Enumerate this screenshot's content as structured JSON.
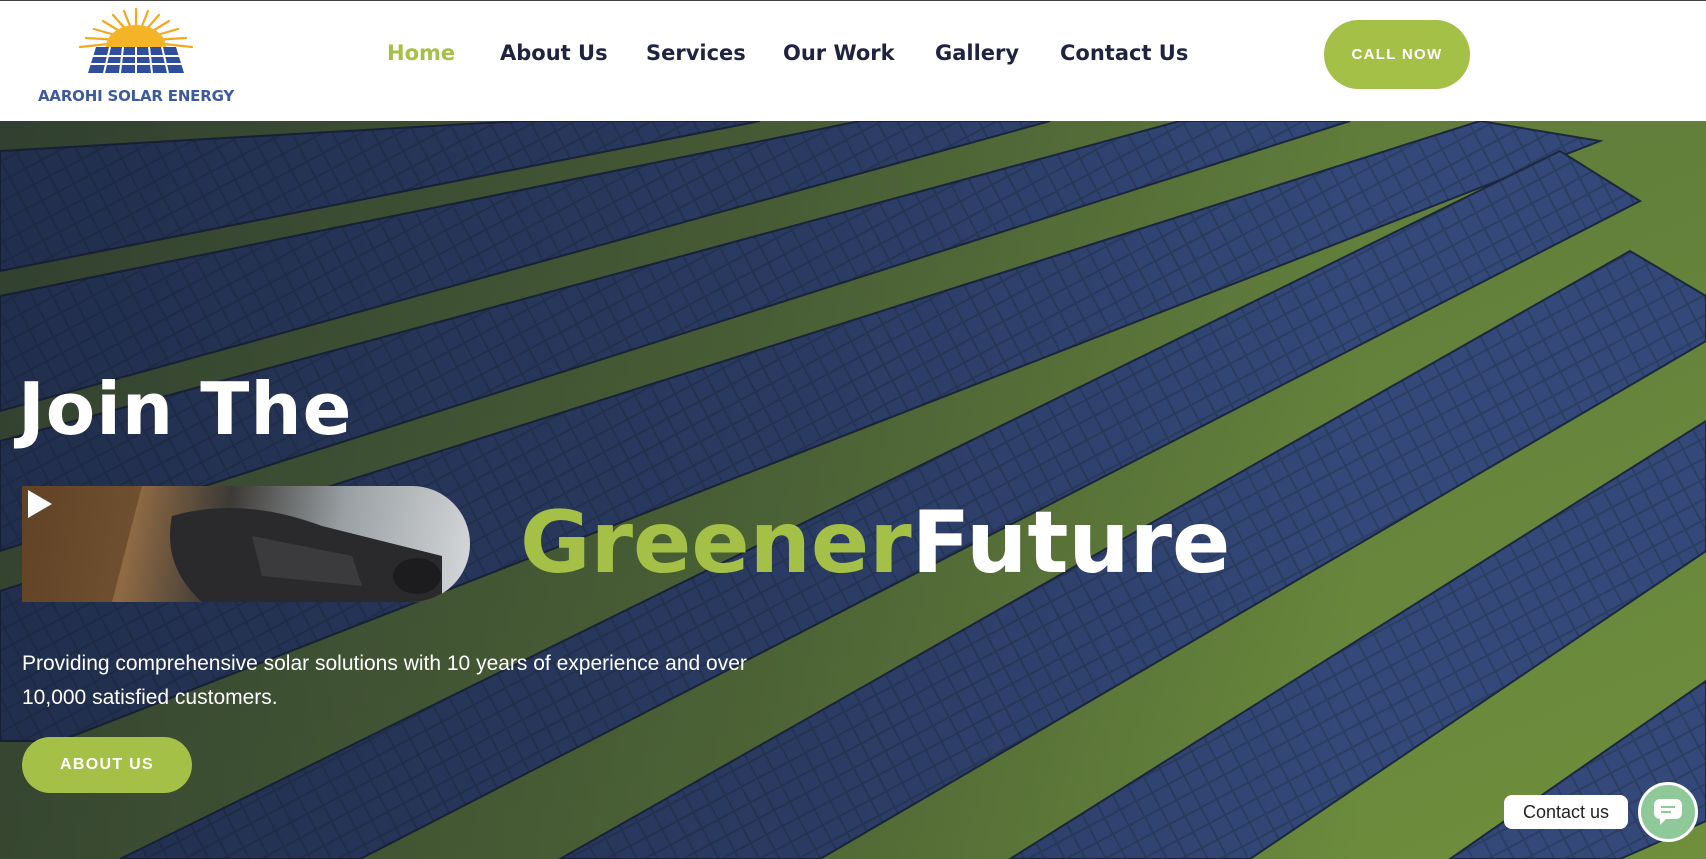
{
  "header": {
    "logo_text": "AAROHI SOLAR ENERGY",
    "nav": [
      {
        "label": "Home",
        "active": true
      },
      {
        "label": "About Us",
        "active": false
      },
      {
        "label": "Services",
        "active": false
      },
      {
        "label": "Our Work",
        "active": false
      },
      {
        "label": "Gallery",
        "active": false
      },
      {
        "label": "Contact Us",
        "active": false
      }
    ],
    "cta_label": "CALL NOW"
  },
  "hero": {
    "title_line1": "Join The",
    "title_green": "Greener",
    "title_white": "Future",
    "description": "Providing comprehensive solar solutions with 10 years of experience and over 10,000 satisfied customers.",
    "button_label": "ABOUT US",
    "video_icon": "play-icon"
  },
  "contact_widget": {
    "label": "Contact us",
    "icon": "chat-icon"
  },
  "colors": {
    "accent": "#a5c046",
    "nav_text": "#1f2340",
    "logo_blue": "#3d5a9c"
  }
}
